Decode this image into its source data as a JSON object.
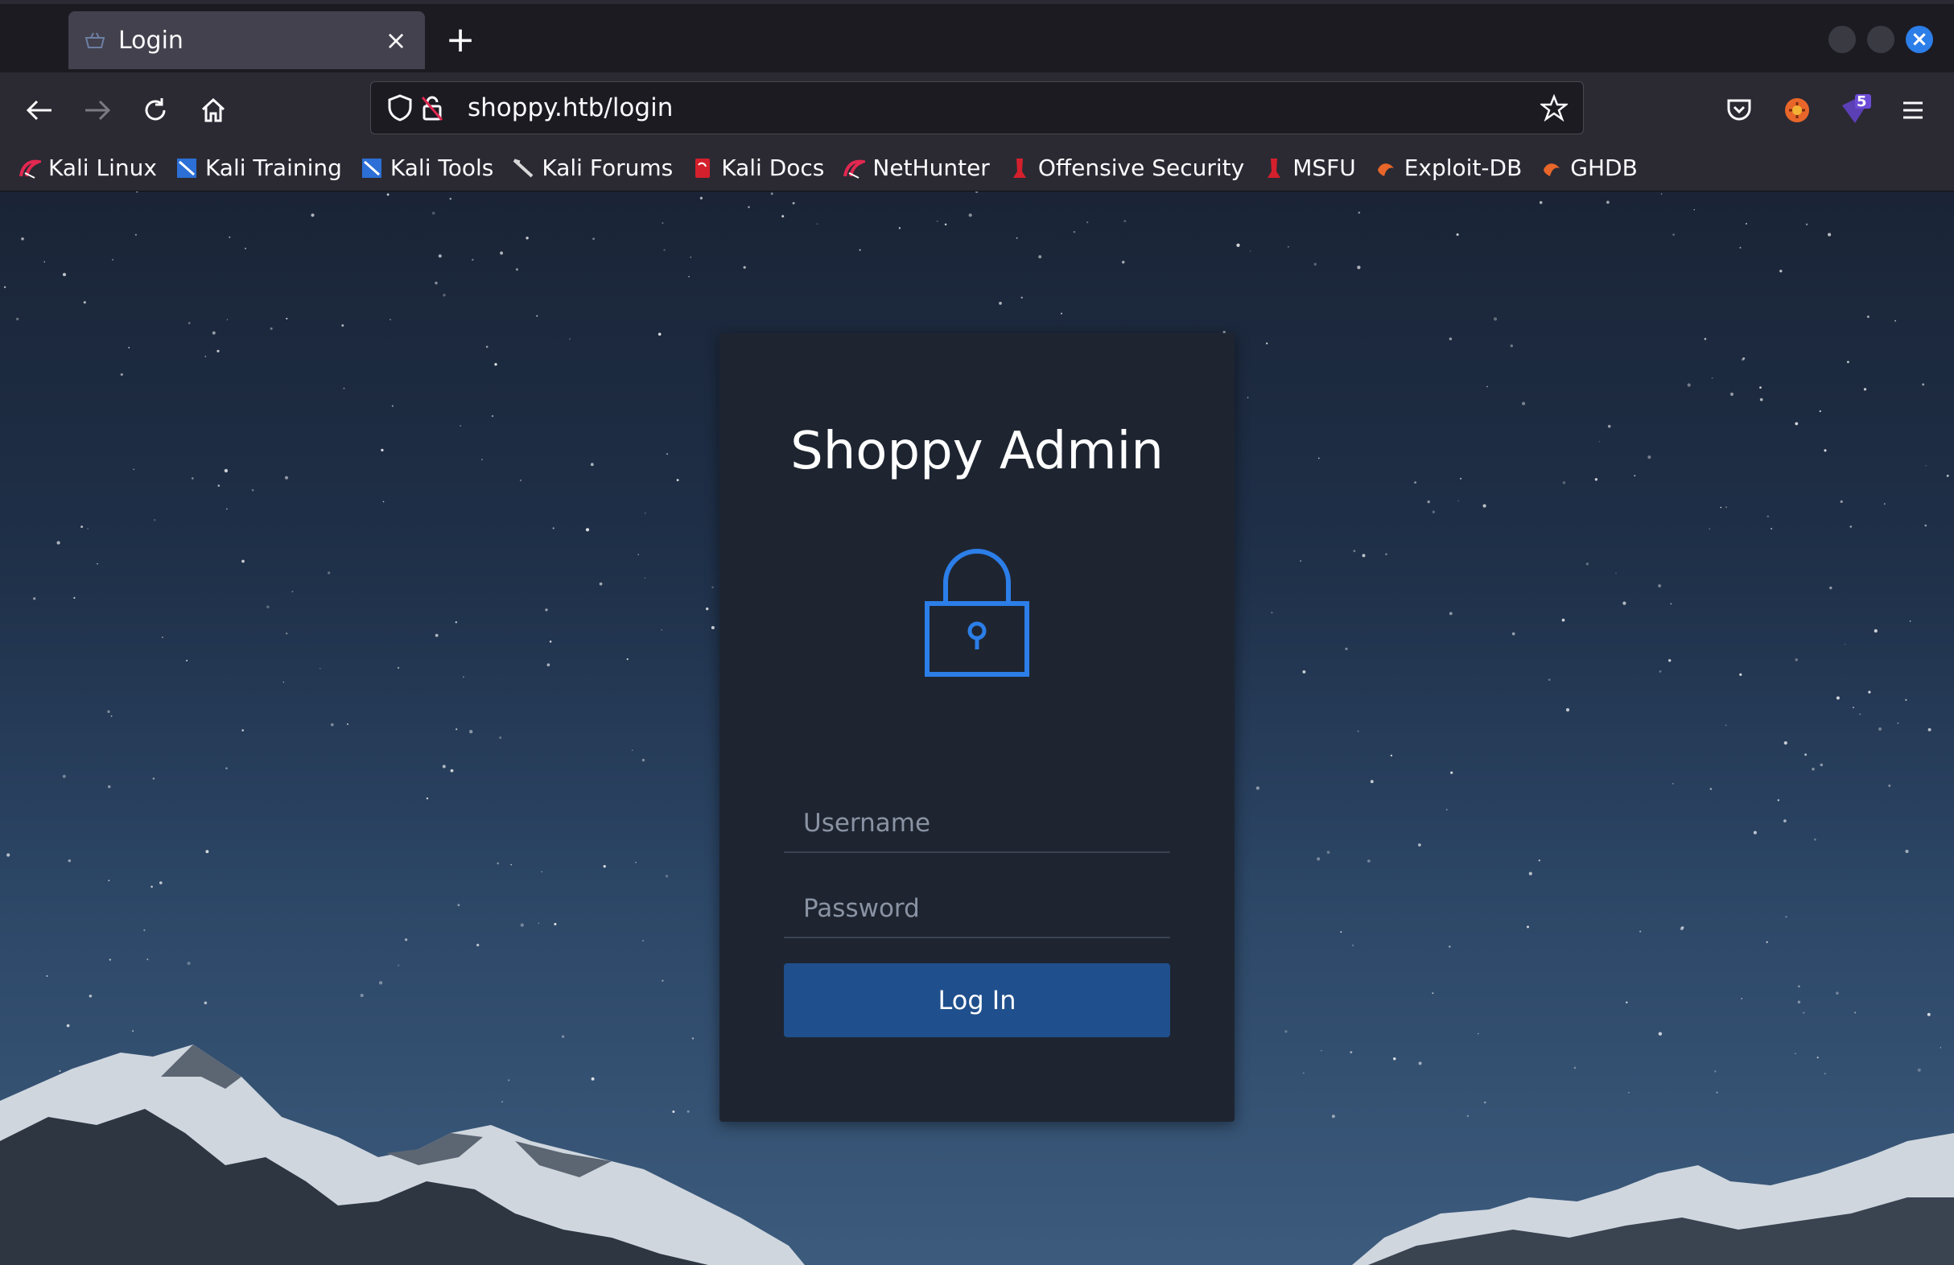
{
  "browser": {
    "tab": {
      "title": "Login",
      "close_glyph": "×"
    },
    "new_tab_glyph": "+",
    "url": "shoppy.htb/login",
    "extension_badge": "5",
    "bookmarks": [
      {
        "label": "Kali Linux",
        "icon": "kali-dragon-icon"
      },
      {
        "label": "Kali Training",
        "icon": "kali-training-icon"
      },
      {
        "label": "Kali Tools",
        "icon": "kali-tools-icon"
      },
      {
        "label": "Kali Forums",
        "icon": "kali-forums-icon"
      },
      {
        "label": "Kali Docs",
        "icon": "kali-docs-icon"
      },
      {
        "label": "NetHunter",
        "icon": "nethunter-icon"
      },
      {
        "label": "Offensive Security",
        "icon": "offsec-icon"
      },
      {
        "label": "MSFU",
        "icon": "msfu-icon"
      },
      {
        "label": "Exploit-DB",
        "icon": "exploit-db-icon"
      },
      {
        "label": "GHDB",
        "icon": "ghdb-icon"
      }
    ]
  },
  "login": {
    "title": "Shoppy Admin",
    "username_placeholder": "Username",
    "password_placeholder": "Password",
    "button_label": "Log In"
  },
  "colors": {
    "accent": "#2c7ee8",
    "button": "#1f4f8c",
    "card": "#1e2531"
  }
}
